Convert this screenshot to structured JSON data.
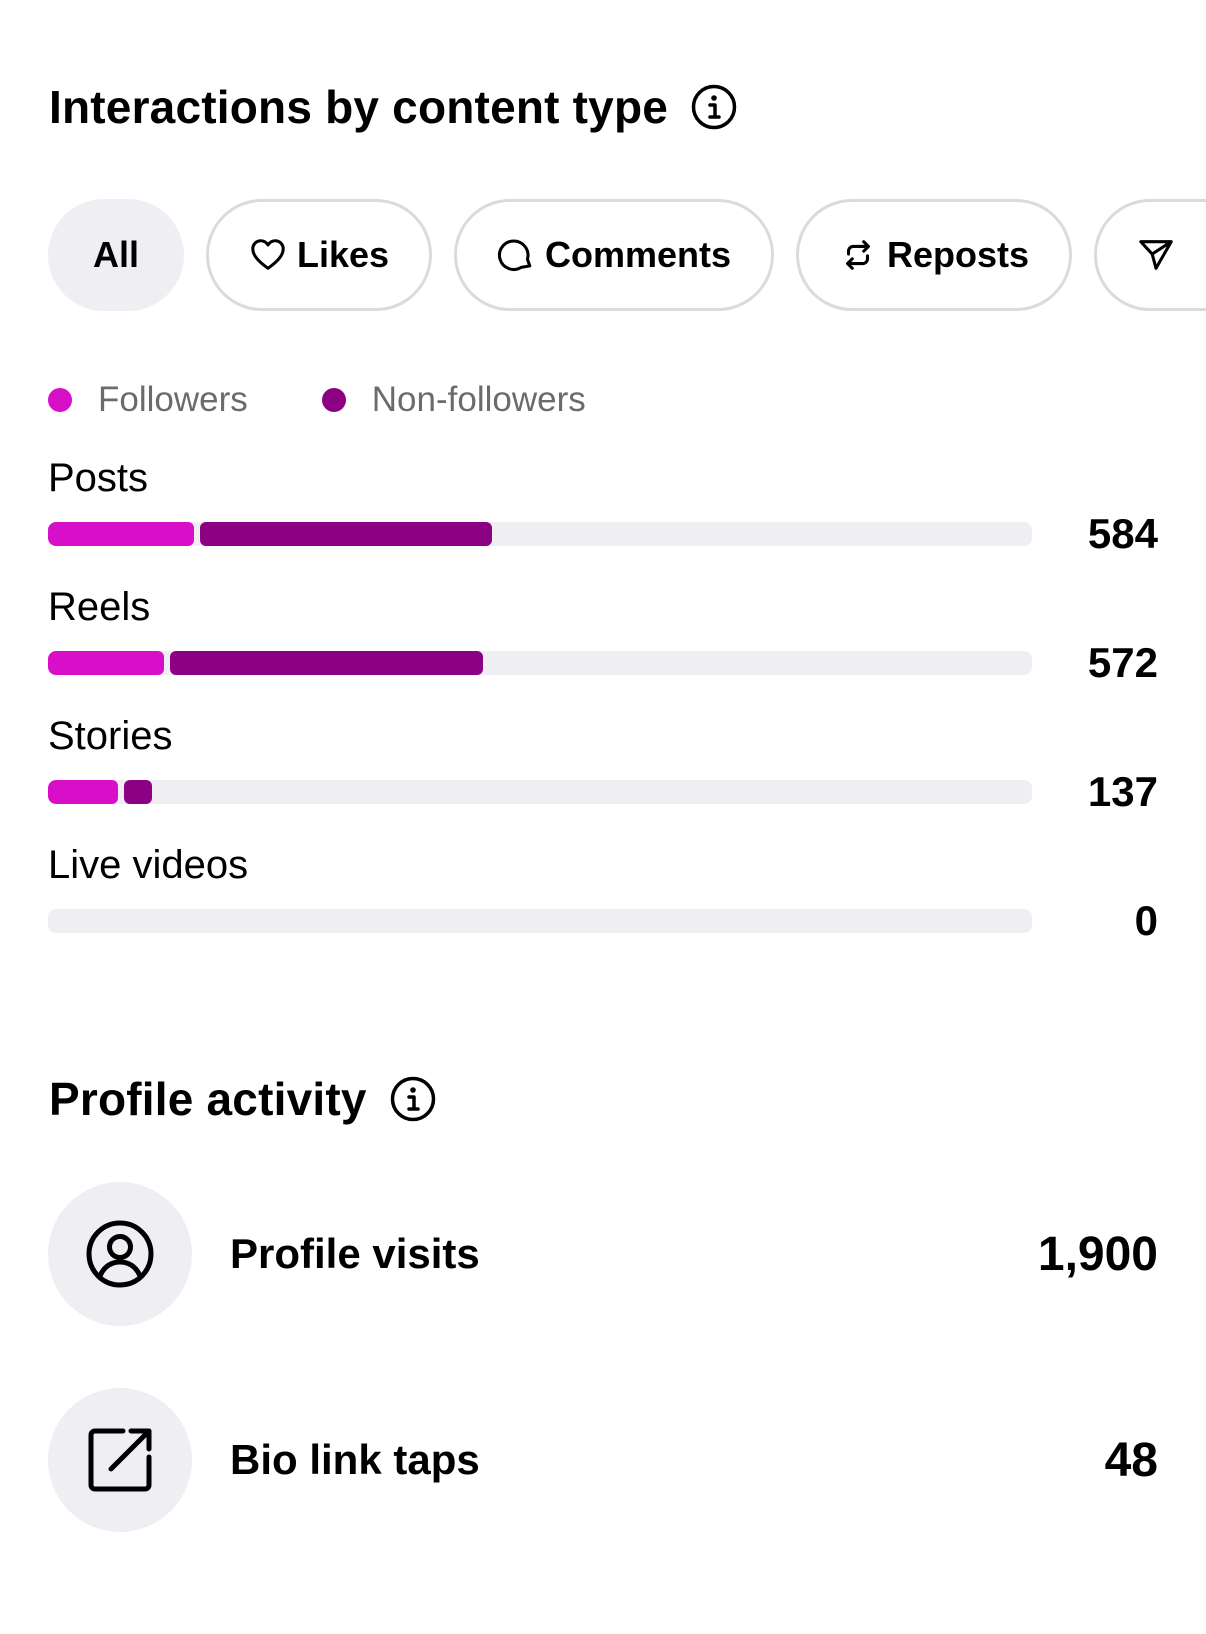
{
  "interactions": {
    "title": "Interactions by content type",
    "info_icon": "info-icon",
    "filters": [
      {
        "label": "All",
        "icon": "",
        "selected": true
      },
      {
        "label": "Likes",
        "icon": "heart-icon",
        "selected": false
      },
      {
        "label": "Comments",
        "icon": "comment-icon",
        "selected": false
      },
      {
        "label": "Reposts",
        "icon": "repost-icon",
        "selected": false
      },
      {
        "label": "",
        "icon": "share-icon",
        "selected": false
      }
    ],
    "legend": [
      {
        "label": "Followers",
        "color": "#d70fc9"
      },
      {
        "label": "Non-followers",
        "color": "#8c0083"
      }
    ],
    "rows": [
      {
        "label": "Posts",
        "value": "584"
      },
      {
        "label": "Reels",
        "value": "572"
      },
      {
        "label": "Stories",
        "value": "137"
      },
      {
        "label": "Live videos",
        "value": "0"
      }
    ]
  },
  "chart_data": {
    "type": "bar",
    "orientation": "horizontal",
    "stacked": true,
    "categories": [
      "Posts",
      "Reels",
      "Stories",
      "Live videos"
    ],
    "totals": [
      584,
      572,
      137,
      0
    ],
    "max": 1294,
    "series": [
      {
        "name": "Followers",
        "color": "#d70fc9",
        "values": [
          200,
          160,
          100,
          0
        ]
      },
      {
        "name": "Non-followers",
        "color": "#8c0083",
        "values": [
          384,
          412,
          37,
          0
        ]
      }
    ]
  },
  "profile": {
    "title": "Profile activity",
    "info_icon": "info-icon",
    "rows": [
      {
        "label": "Profile visits",
        "value": "1,900",
        "icon": "profile-icon"
      },
      {
        "label": "Bio link taps",
        "value": "48",
        "icon": "external-link-icon"
      }
    ]
  }
}
